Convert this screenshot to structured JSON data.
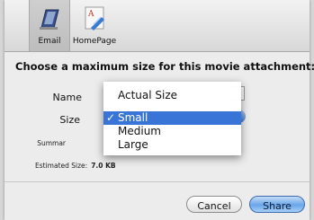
{
  "toolbar": {
    "items": [
      {
        "label": "Email",
        "icon": "email-icon",
        "selected": true
      },
      {
        "label": "HomePage",
        "icon": "homepage-icon",
        "selected": false
      }
    ]
  },
  "form": {
    "heading": "Choose a maximum size for this movie attachment:",
    "name_label": "Name",
    "size_label": "Size",
    "summary_label": "Summar",
    "estimated_label": "Estimated Size:",
    "estimated_value": "7.0 KB"
  },
  "size_menu": {
    "items": [
      {
        "label": "Actual Size",
        "checked": false,
        "highlighted": false
      },
      {
        "label": "Small",
        "checked": true,
        "highlighted": true
      },
      {
        "label": "Medium",
        "checked": false,
        "highlighted": false
      },
      {
        "label": "Large",
        "checked": false,
        "highlighted": false
      }
    ],
    "check_mark": "✓"
  },
  "buttons": {
    "cancel": "Cancel",
    "share": "Share"
  },
  "colors": {
    "highlight": "#3875d7",
    "default_button": "#6aa6ea"
  }
}
